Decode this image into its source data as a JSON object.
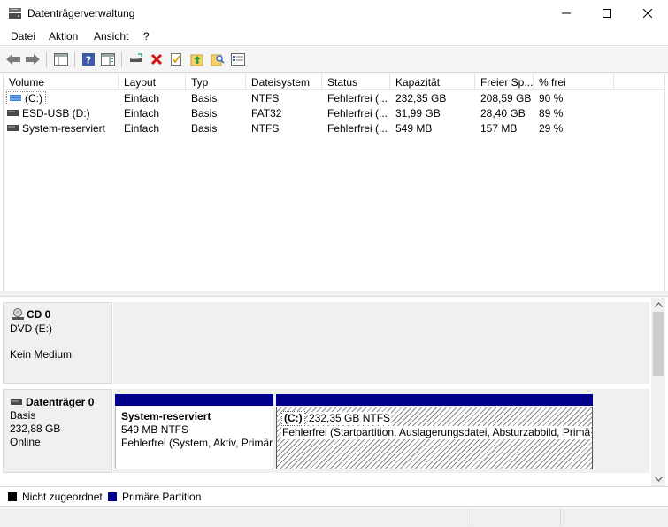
{
  "window": {
    "title": "Datenträgerverwaltung"
  },
  "menu": [
    "Datei",
    "Aktion",
    "Ansicht",
    "?"
  ],
  "toolbar": {
    "icons": [
      "back-arrow-icon",
      "forward-arrow-icon",
      "console-tree-icon",
      "help-icon",
      "action-pane-icon",
      "connect-drive-icon",
      "delete-icon",
      "properties-icon",
      "folder-up-icon",
      "find-icon",
      "list-view-icon"
    ]
  },
  "volume_table": {
    "columns": [
      "Volume",
      "Layout",
      "Typ",
      "Dateisystem",
      "Status",
      "Kapazität",
      "Freier Sp...",
      "% frei"
    ],
    "rows": [
      {
        "volume": "(C:)",
        "layout": "Einfach",
        "typ": "Basis",
        "dateisystem": "NTFS",
        "status": "Fehlerfrei (...",
        "kapazitaet": "232,35 GB",
        "frei": "208,59 GB",
        "prozent": "90 %",
        "icon": "striped-volume-icon"
      },
      {
        "volume": "ESD-USB (D:)",
        "layout": "Einfach",
        "typ": "Basis",
        "dateisystem": "FAT32",
        "status": "Fehlerfrei (...",
        "kapazitaet": "31,99 GB",
        "frei": "28,40 GB",
        "prozent": "89 %",
        "icon": "volume-icon"
      },
      {
        "volume": "System-reserviert",
        "layout": "Einfach",
        "typ": "Basis",
        "dateisystem": "NTFS",
        "status": "Fehlerfrei (...",
        "kapazitaet": "549 MB",
        "frei": "157 MB",
        "prozent": "29 %",
        "icon": "volume-icon"
      }
    ]
  },
  "disks": {
    "cd0": {
      "name": "CD 0",
      "drive": "DVD (E:)",
      "medium": "Kein Medium"
    },
    "disk0": {
      "name": "Datenträger 0",
      "type": "Basis",
      "size": "232,88 GB",
      "state": "Online",
      "partitions": [
        {
          "name": "System-reserviert",
          "size": "549 MB NTFS",
          "status": "Fehlerfrei (System, Aktiv, Primär"
        },
        {
          "name": "(C:)",
          "size": "232,35 GB NTFS",
          "status": "Fehlerfrei (Startpartition, Auslagerungsdatei, Absturzabbild, Primä"
        }
      ]
    }
  },
  "legend": [
    {
      "label": "Nicht zugeordnet",
      "color": "#000000"
    },
    {
      "label": "Primäre Partition",
      "color": "#00008b"
    }
  ],
  "colors": {
    "primary_partition": "#00008b",
    "selection": "#cce8ff"
  }
}
